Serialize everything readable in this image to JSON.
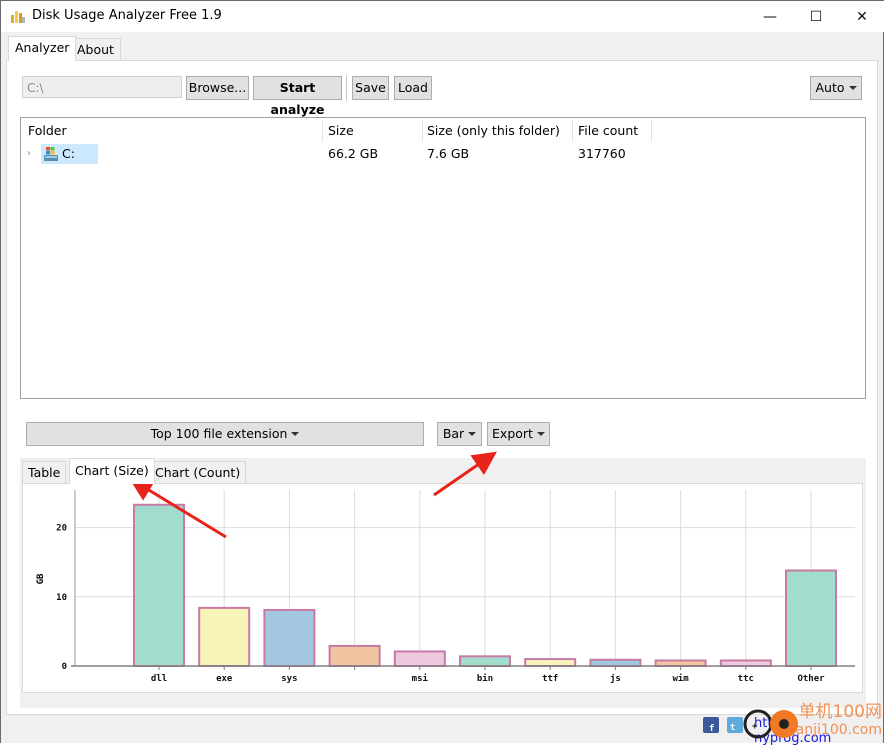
{
  "window": {
    "title": "Disk Usage Analyzer Free 1.9",
    "minimize_label": "—",
    "maximize_label": "☐",
    "close_label": "✕"
  },
  "main_tabs": [
    {
      "label": "Analyzer",
      "active": true
    },
    {
      "label": "About",
      "active": false
    }
  ],
  "toolbar": {
    "path_value": "C:\\",
    "browse_label": "Browse...",
    "start_label": "Start analyze",
    "save_label": "Save",
    "load_label": "Load",
    "auto_label": "Auto"
  },
  "tree": {
    "columns": [
      "Folder",
      "Size",
      "Size (only this folder)",
      "File count"
    ],
    "rows": [
      {
        "folder": "C:",
        "size": "66.2 GB",
        "size_only": "7.6 GB",
        "file_count": "317760",
        "selected": true
      }
    ]
  },
  "controls": {
    "group_label": "Top 100 file extension",
    "chart_type_label": "Bar",
    "export_label": "Export"
  },
  "chart_tabs": [
    {
      "label": "Table",
      "active": false
    },
    {
      "label": "Chart (Size)",
      "active": true
    },
    {
      "label": "Chart (Count)",
      "active": false
    }
  ],
  "footer": {
    "link_text": "http://",
    "link_text_end": "nyprog.com",
    "watermark_line1": "单机100网",
    "watermark_line2": "danji100.com"
  },
  "colors": {
    "bar_border": "#c87aa6",
    "bar_fills": [
      "#a2dccc",
      "#f8f3b9",
      "#a3c7e0",
      "#efc49f",
      "#ecc9dc"
    ],
    "annotation_arrow": "#e8231c"
  },
  "chart_data": {
    "type": "bar",
    "title": "",
    "xlabel": "",
    "ylabel": "GB",
    "categories": [
      "dll",
      "exe",
      "sys",
      "",
      "msi",
      "bin",
      "ttf",
      "js",
      "wim",
      "ttc",
      "Other"
    ],
    "values": [
      23.3,
      8.4,
      8.1,
      2.9,
      2.1,
      1.4,
      1.0,
      0.9,
      0.8,
      0.8,
      13.8
    ],
    "ylim": [
      0,
      26
    ],
    "yticks": [
      0,
      10,
      20
    ],
    "grid": true,
    "legend": "none"
  }
}
